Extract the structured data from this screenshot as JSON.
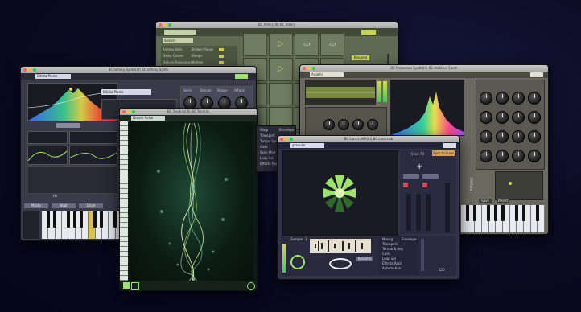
{
  "windows": {
    "artery": {
      "title": "BC Artery(III) BC Artery",
      "preset": "Search",
      "btn": "Rename",
      "rows": [
        "Analog Bells",
        "Delay Center",
        "Detune Resonance",
        "Artery(III)"
      ],
      "rows2": [
        "Bridge Pianos",
        "Bleeps",
        "Mellow",
        "Analog"
      ]
    },
    "infinity": {
      "title": "BC Infinity Synth(III) BC Infinity Synth",
      "preset": "Bifolia Plains",
      "preset2": "Bifolia Plains",
      "knob_labels": [
        "Semi",
        "Detune",
        "Shape",
        "Attack"
      ],
      "btn_bottom": [
        "Plucky",
        "Beat",
        "Drive"
      ],
      "side_label": "Hz"
    },
    "additive": {
      "title": "BC Projection Synth(III) BC Additive Synth",
      "preset": "Angelic",
      "btns": [
        "Save",
        "Preset"
      ],
      "side_label": "FM Rate"
    },
    "tendrils": {
      "title": "BC Tendrils(III) BC Tendrils",
      "preset": "Dream Pulse",
      "menu": [
        "Warp",
        "Transport",
        "Tempo Sync",
        "Gate",
        "Sync Mod",
        "Loop Sel",
        "Effects Rack"
      ],
      "menu2": [
        "Envelope"
      ]
    },
    "luna": {
      "title": "BC Luna LABS(III) BC Luna Lab",
      "preset": "granular",
      "sync_label": "Sync 70",
      "btn": "Sync to Luna",
      "sampler": "Sampler 1",
      "bottom_btn": "Rename",
      "menu": [
        "Mixing",
        "Transport",
        "Tempo & Key",
        "Cues",
        "Loop Sel",
        "Effects Rack",
        "Automation"
      ],
      "menu2": [
        "Envelope"
      ],
      "value": "120"
    }
  },
  "colors": {
    "bg": "#05051a",
    "artery_bg": "#5e6b52",
    "artery_accent": "#c9d64b",
    "synth_bg": "#3a3a4a",
    "additive_bg": "#6a6a60",
    "tendrils_bg": "#0e1a14",
    "luna_bg": "#32324a",
    "lime": "#9be36b"
  }
}
